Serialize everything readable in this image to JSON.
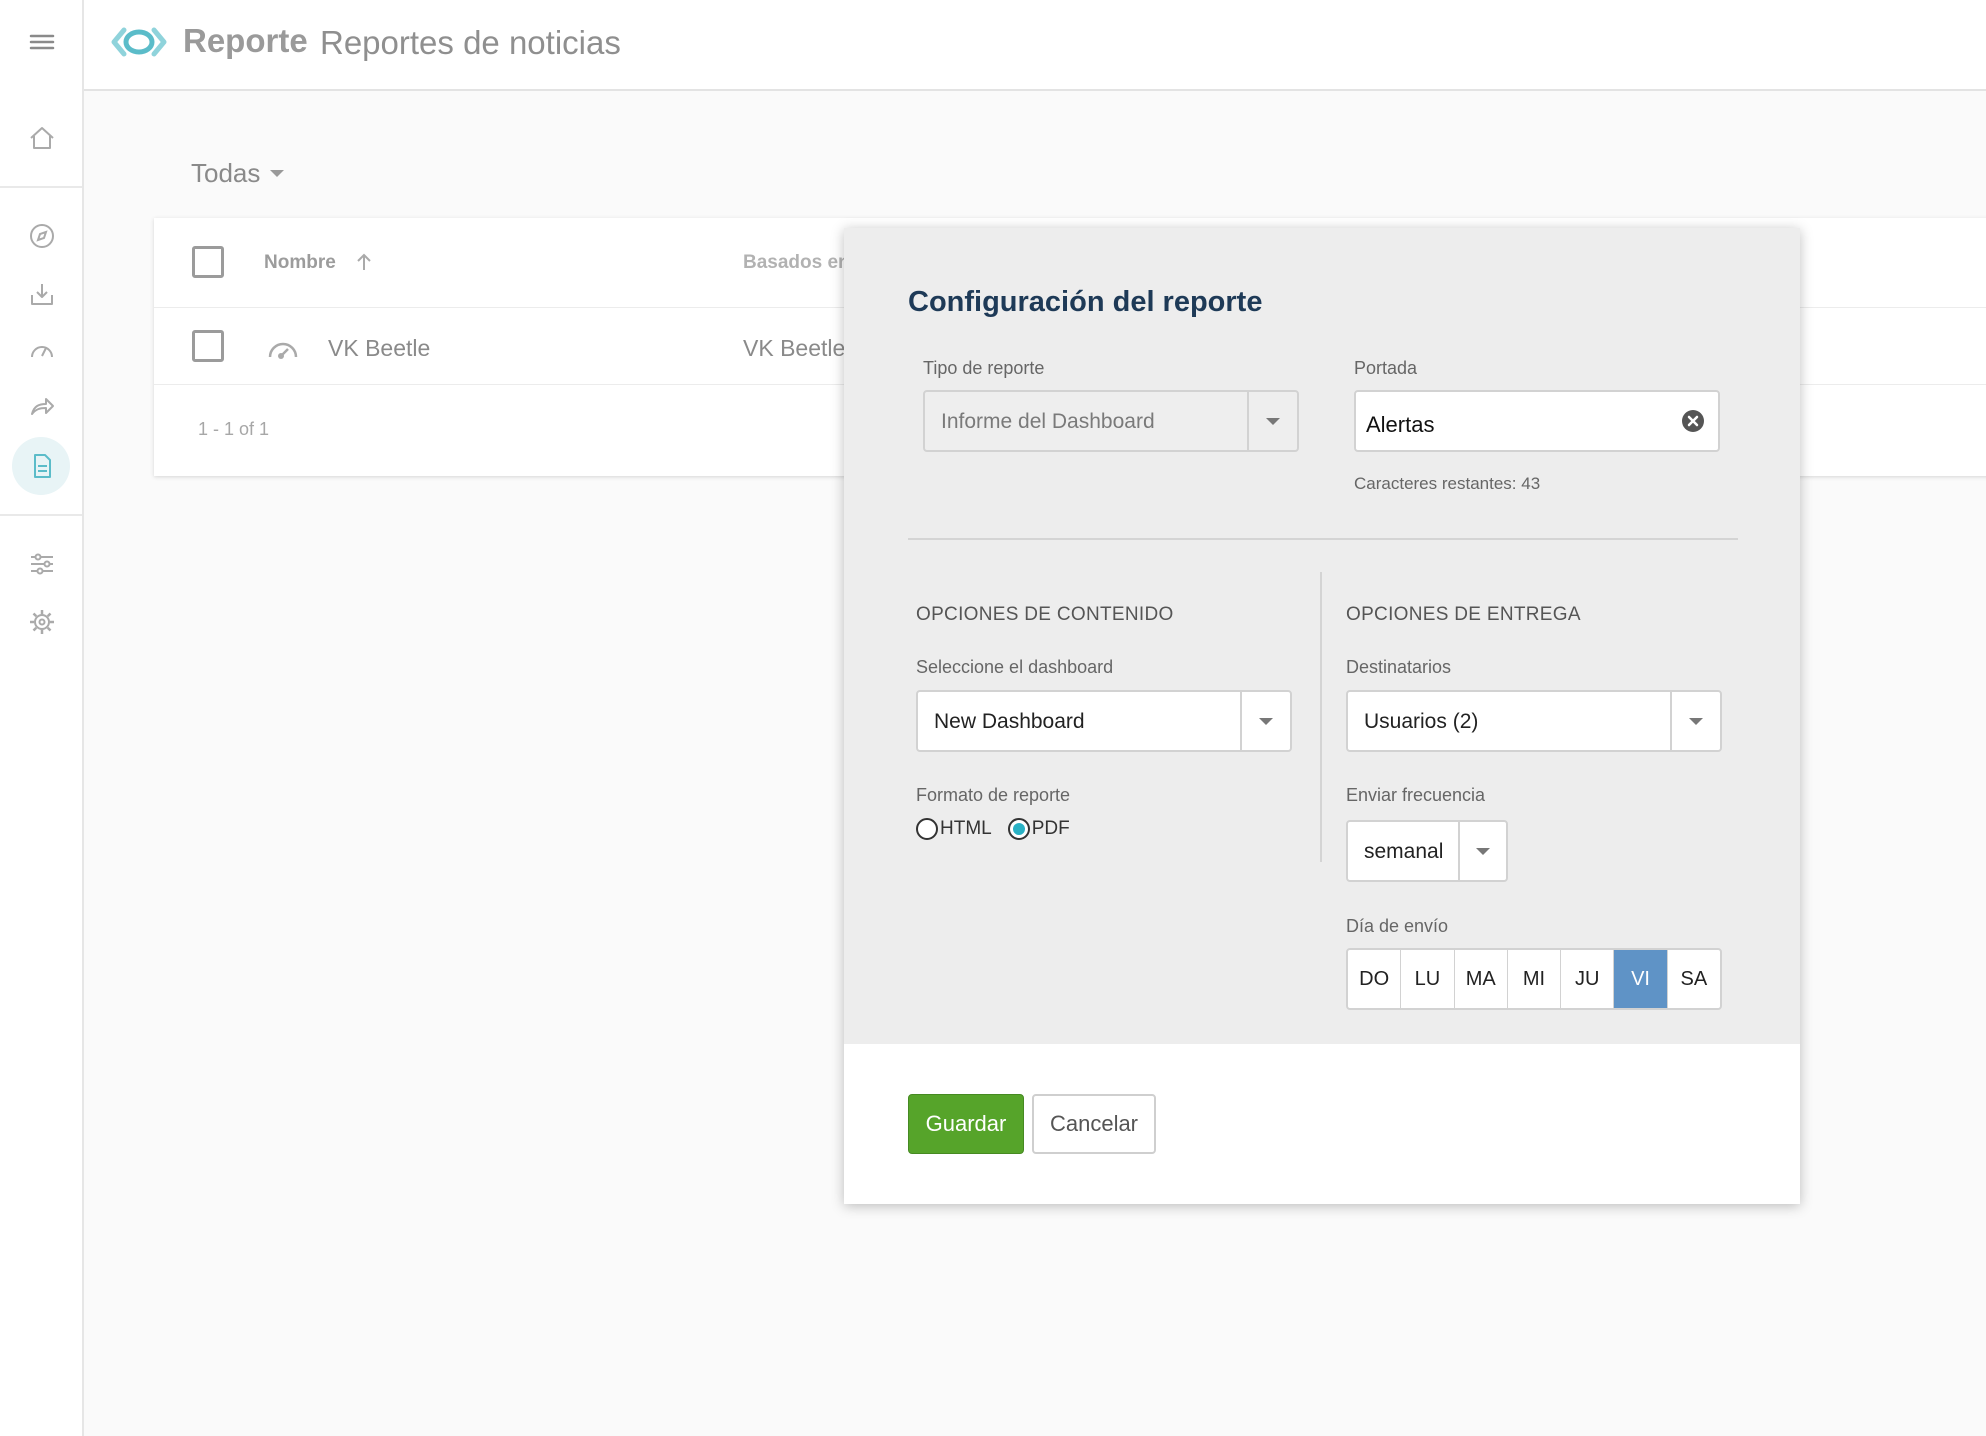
{
  "header": {
    "brand": "Reporte",
    "title": "Reportes de noticias"
  },
  "sidebar": {
    "items": [
      {
        "icon": "menu-icon"
      },
      {
        "icon": "home-icon"
      },
      {
        "icon": "compass-icon"
      },
      {
        "icon": "inbox-download-icon"
      },
      {
        "icon": "gauge-icon"
      },
      {
        "icon": "share-arrow-icon"
      },
      {
        "icon": "report-document-icon",
        "active": true
      },
      {
        "icon": "sliders-icon"
      },
      {
        "icon": "gear-icon"
      }
    ]
  },
  "filter": {
    "label": "Todas"
  },
  "table": {
    "columns": [
      "Nombre",
      "Basados en"
    ],
    "rows": [
      {
        "name": "VK Beetle",
        "based_on": "VK Beetle"
      }
    ],
    "pagination": "1 - 1 of 1"
  },
  "modal": {
    "title": "Configuración del reporte",
    "report_type": {
      "label": "Tipo de reporte",
      "value": "Informe del Dashboard"
    },
    "cover": {
      "label": "Portada",
      "value": "Alertas",
      "hint": "Caracteres restantes: 43"
    },
    "content": {
      "section": "OPCIONES DE CONTENIDO",
      "dashboard_label": "Seleccione el dashboard",
      "dashboard_value": "New Dashboard",
      "format_label": "Formato de reporte",
      "format_options": [
        "HTML",
        "PDF"
      ],
      "format_selected": "PDF"
    },
    "delivery": {
      "section": "OPCIONES DE ENTREGA",
      "recipients_label": "Destinatarios",
      "recipients_value": "Usuarios (2)",
      "frequency_label": "Enviar frecuencia",
      "frequency_value": "semanal",
      "day_label": "Día de envío",
      "days": [
        "DO",
        "LU",
        "MA",
        "MI",
        "JU",
        "VI",
        "SA"
      ],
      "selected_day": "VI"
    },
    "save_label": "Guardar",
    "cancel_label": "Cancelar"
  },
  "colors": {
    "accent": "#29b1c4",
    "save": "#56a42a",
    "day_selected": "#5f93c6",
    "title": "#1e3a57"
  }
}
